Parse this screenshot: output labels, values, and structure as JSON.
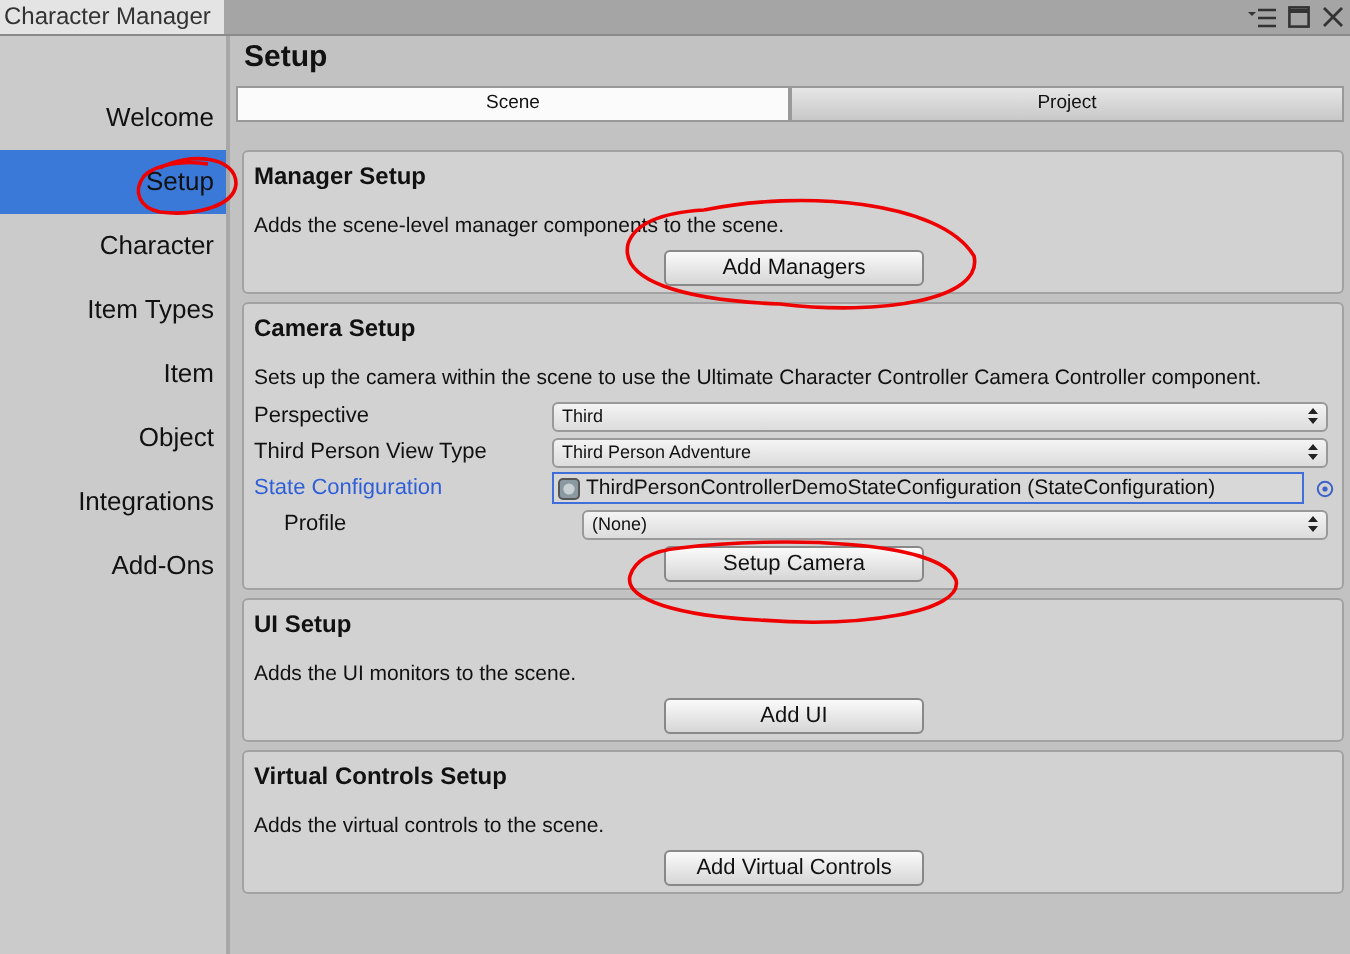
{
  "window": {
    "title": "Character Manager"
  },
  "sidebar": {
    "items": [
      {
        "label": "Welcome",
        "selected": false
      },
      {
        "label": "Setup",
        "selected": true
      },
      {
        "label": "Character",
        "selected": false
      },
      {
        "label": "Item Types",
        "selected": false
      },
      {
        "label": "Item",
        "selected": false
      },
      {
        "label": "Object",
        "selected": false
      },
      {
        "label": "Integrations",
        "selected": false
      },
      {
        "label": "Add-Ons",
        "selected": false
      }
    ]
  },
  "heading": "Setup",
  "tabs": [
    {
      "label": "Scene",
      "selected": true
    },
    {
      "label": "Project",
      "selected": false
    }
  ],
  "sections": [
    {
      "title": "Manager Setup",
      "description": "Adds the scene-level manager components to the scene.",
      "button": "Add Managers"
    },
    {
      "title": "Camera Setup",
      "description": "Sets up the camera within the scene to use the Ultimate Character Controller Camera Controller component.",
      "fields": [
        {
          "kind": "dropdown",
          "label": "Perspective",
          "value": "Third"
        },
        {
          "kind": "dropdown",
          "label": "Third Person View Type",
          "value": "Third Person Adventure"
        },
        {
          "kind": "object",
          "label": "State Configuration",
          "value": "ThirdPersonControllerDemoStateConfiguration (StateConfiguration)",
          "children": [
            {
              "kind": "dropdown",
              "label": "Profile",
              "value": "(None)"
            }
          ]
        }
      ],
      "button": "Setup Camera"
    },
    {
      "title": "UI Setup",
      "description": "Adds the UI monitors to the scene.",
      "button": "Add UI"
    },
    {
      "title": "Virtual Controls Setup",
      "description": "Adds the virtual controls to the scene.",
      "button": "Add Virtual Controls"
    }
  ]
}
